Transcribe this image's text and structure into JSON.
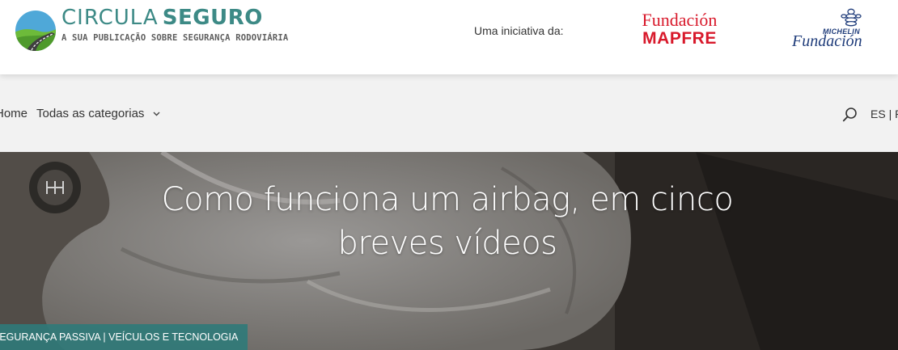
{
  "header": {
    "brand_light": "CIRCULA",
    "brand_bold": "SEGURO",
    "tagline": "A SUA PUBLICAÇÃO SOBRE SEGURANÇA RODOVIÁRIA",
    "initiative_label": "Uma iniciativa da:",
    "partner_mapfre": {
      "line1": "Fundación",
      "line2": "MAPFRE"
    },
    "partner_michelin": {
      "word": "MICHELIN",
      "line": "Fundación"
    }
  },
  "nav": {
    "home": "Home",
    "categories": "Todas as categorias",
    "language": "ES | P"
  },
  "hero": {
    "title": "Como funciona um airbag, em cinco breves vídeos",
    "category": "SEGURANÇA PASSIVA | VEÍCULOS E TECNOLOGIA"
  },
  "colors": {
    "brand_teal": "#3d8a86",
    "mapfre_red": "#d8192b",
    "michelin_blue": "#1f3c7a",
    "tag_background": "#2f7a79"
  },
  "icons": {
    "logo": "road-globe-logo",
    "search": "search-icon",
    "dropdown": "chevron-down-icon",
    "michelin": "michelin-man-icon"
  }
}
